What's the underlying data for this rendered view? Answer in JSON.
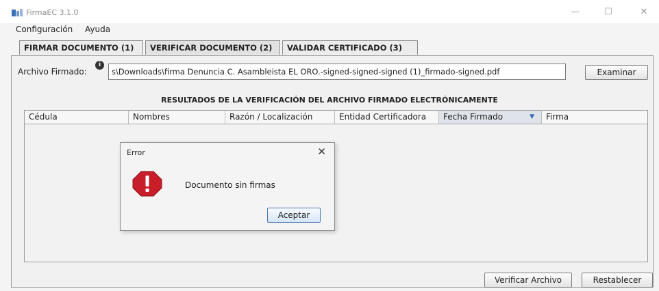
{
  "window": {
    "title": "FirmaEC 3.1.0",
    "controls": [
      "minimize-icon",
      "maximize-icon",
      "close-icon"
    ]
  },
  "menu": [
    {
      "label": "Configuración"
    },
    {
      "label": "Ayuda"
    }
  ],
  "tabs": [
    {
      "label": "FIRMAR DOCUMENTO (1)",
      "active": false
    },
    {
      "label": "VERIFICAR DOCUMENTO (2)",
      "active": true
    },
    {
      "label": "VALIDAR CERTIFICADO (3)",
      "active": false
    }
  ],
  "form": {
    "archivo_label": "Archivo Firmado:",
    "path_value": "s\\Downloads\\firma Denuncia C. Asambleista EL ORO.-signed-signed-signed (1)_firmado-signed.pdf",
    "examinar_label": "Examinar"
  },
  "results": {
    "title": "RESULTADOS DE LA VERIFICACIÓN DEL ARCHIVO FIRMADO ELECTRÓNICAMENTE",
    "columns": [
      "Cédula",
      "Nombres",
      "Razón / Localización",
      "Entidad Certificadora",
      "Fecha Firmado",
      "Firma"
    ],
    "sorted_column": "Fecha Firmado",
    "rows": []
  },
  "dialog": {
    "title": "Error",
    "message": "Documento sin firmas",
    "accept_label": "Aceptar",
    "icon": "error-icon"
  },
  "footer": {
    "verify_label": "Verificar Archivo",
    "reset_label": "Restablecer"
  },
  "colors": {
    "error_red": "#c81e2a",
    "accent_blue": "#4a78b5"
  }
}
